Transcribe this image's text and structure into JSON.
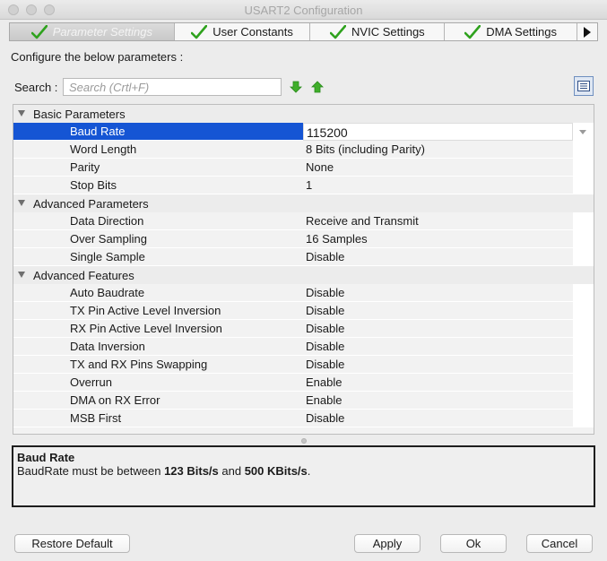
{
  "window": {
    "title": "USART2 Configuration"
  },
  "tabs": [
    {
      "label": "Parameter Settings"
    },
    {
      "label": "User Constants"
    },
    {
      "label": "NVIC Settings"
    },
    {
      "label": "DMA Settings"
    }
  ],
  "configure_label": "Configure the below parameters :",
  "search": {
    "label": "Search :",
    "placeholder": "Search (Crtl+F)",
    "value": ""
  },
  "groups": [
    {
      "title": "Basic Parameters",
      "items": [
        {
          "name": "Baud Rate",
          "value": "115200"
        },
        {
          "name": "Word Length",
          "value": "8 Bits (including Parity)"
        },
        {
          "name": "Parity",
          "value": "None"
        },
        {
          "name": "Stop Bits",
          "value": "1"
        }
      ]
    },
    {
      "title": "Advanced Parameters",
      "items": [
        {
          "name": "Data Direction",
          "value": "Receive and Transmit"
        },
        {
          "name": "Over Sampling",
          "value": "16 Samples"
        },
        {
          "name": "Single Sample",
          "value": "Disable"
        }
      ]
    },
    {
      "title": "Advanced Features",
      "items": [
        {
          "name": "Auto Baudrate",
          "value": "Disable"
        },
        {
          "name": "TX Pin Active Level Inversion",
          "value": "Disable"
        },
        {
          "name": "RX Pin Active Level Inversion",
          "value": "Disable"
        },
        {
          "name": "Data Inversion",
          "value": "Disable"
        },
        {
          "name": "TX and RX Pins Swapping",
          "value": "Disable"
        },
        {
          "name": "Overrun",
          "value": "Enable"
        },
        {
          "name": "DMA on RX Error",
          "value": "Enable"
        },
        {
          "name": "MSB First",
          "value": "Disable"
        }
      ]
    }
  ],
  "description": {
    "title": "Baud Rate",
    "text_prefix": "BaudRate must be between ",
    "min": "123 Bits/s",
    "text_middle": " and ",
    "max": "500 KBits/s",
    "text_suffix": "."
  },
  "buttons": {
    "restore_default": "Restore Default",
    "apply": "Apply",
    "ok": "Ok",
    "cancel": "Cancel"
  },
  "colors": {
    "selection": "#1555d4",
    "check_green": "#2fa21e",
    "arrow_green": "#3fae2a"
  }
}
